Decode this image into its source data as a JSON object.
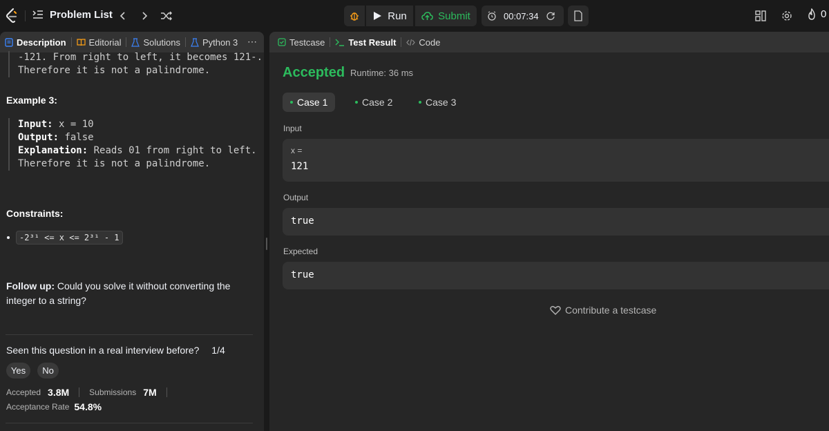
{
  "header": {
    "problem_list": "Problem List",
    "run": "Run",
    "submit": "Submit",
    "timer": "00:07:34",
    "streak": "0"
  },
  "left_tabs": [
    "Description",
    "Editorial",
    "Solutions",
    "Python 3"
  ],
  "description": {
    "top_line1": "-121. From right to left, it becomes 121-.",
    "top_line2": "Therefore it is not a palindrome.",
    "example3_title": "Example 3:",
    "ex3_input_label": "Input:",
    "ex3_input_value": "x = 10",
    "ex3_output_label": "Output:",
    "ex3_output_value": "false",
    "ex3_expl_label": "Explanation:",
    "ex3_expl_value": "Reads 01 from right to left.",
    "ex3_expl_line2": "Therefore it is not a palindrome.",
    "constraints_title": "Constraints:",
    "constraint_text": "-2³¹ <= x <= 2³¹ - 1",
    "followup_label": "Follow up:",
    "followup_text": "Could you solve it without converting the",
    "followup_text2": "integer to a string?",
    "interview_q": "Seen this question in a real interview before?",
    "interview_count": "1/4",
    "yes": "Yes",
    "no": "No",
    "accepted_label": "Accepted",
    "accepted_value": "3.8M",
    "submissions_label": "Submissions",
    "submissions_value": "7M",
    "rate_label": "Acceptance Rate",
    "rate_value": "54.8%"
  },
  "right_tabs": [
    "Testcase",
    "Test Result",
    "Code"
  ],
  "result": {
    "status": "Accepted",
    "runtime": "Runtime: 36 ms",
    "cases": [
      "Case 1",
      "Case 2",
      "Case 3"
    ],
    "input_label": "Input",
    "input_var": "x =",
    "input_value": "121",
    "output_label": "Output",
    "output_value": "true",
    "expected_label": "Expected",
    "expected_value": "true",
    "contribute": "Contribute a testcase"
  },
  "colors": {
    "accent_green": "#2cbb5d",
    "bg": "#1a1a1a",
    "panel": "#262626"
  }
}
